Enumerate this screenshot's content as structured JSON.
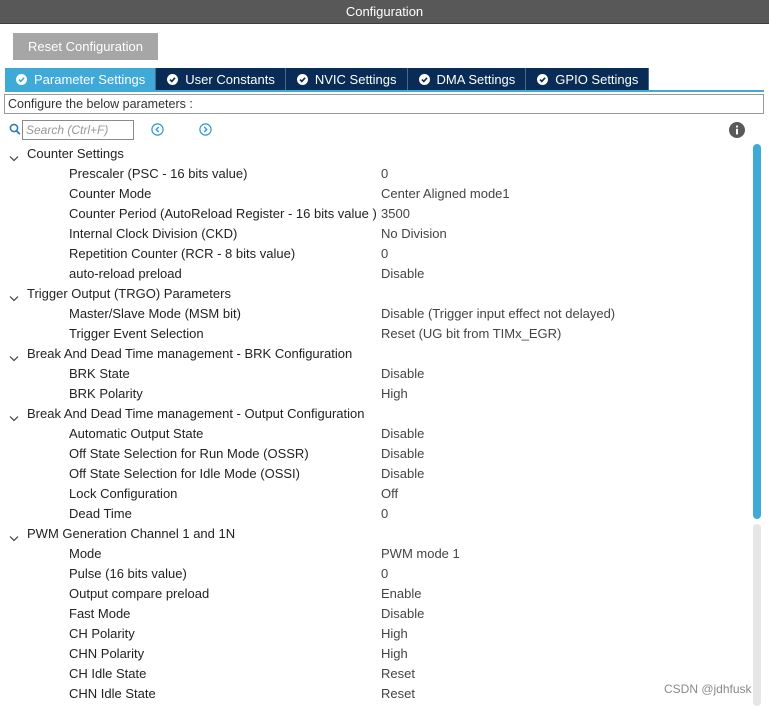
{
  "window": {
    "title": "Configuration"
  },
  "toolbar": {
    "reset_label": "Reset Configuration"
  },
  "tabs": [
    {
      "label": "Parameter Settings",
      "active": true
    },
    {
      "label": "User Constants",
      "active": false
    },
    {
      "label": "NVIC Settings",
      "active": false
    },
    {
      "label": "DMA Settings",
      "active": false
    },
    {
      "label": "GPIO Settings",
      "active": false
    }
  ],
  "description": "Configure the below parameters :",
  "search": {
    "placeholder": "Search (Ctrl+F)"
  },
  "groups": [
    {
      "name": "Counter Settings",
      "params": [
        {
          "name": "Prescaler (PSC - 16 bits value)",
          "value": "0"
        },
        {
          "name": "Counter Mode",
          "value": "Center Aligned mode1"
        },
        {
          "name": "Counter Period (AutoReload Register - 16 bits value )",
          "value": "3500"
        },
        {
          "name": "Internal Clock Division (CKD)",
          "value": "No Division"
        },
        {
          "name": "Repetition Counter (RCR - 8 bits value)",
          "value": "0"
        },
        {
          "name": "auto-reload preload",
          "value": "Disable"
        }
      ]
    },
    {
      "name": "Trigger Output (TRGO) Parameters",
      "params": [
        {
          "name": "Master/Slave Mode (MSM bit)",
          "value": "Disable (Trigger input effect not delayed)"
        },
        {
          "name": "Trigger Event Selection",
          "value": "Reset (UG bit from TIMx_EGR)"
        }
      ]
    },
    {
      "name": "Break And Dead Time management - BRK Configuration",
      "params": [
        {
          "name": "BRK State",
          "value": "Disable"
        },
        {
          "name": "BRK Polarity",
          "value": "High"
        }
      ]
    },
    {
      "name": "Break And Dead Time management - Output Configuration",
      "params": [
        {
          "name": "Automatic Output State",
          "value": "Disable"
        },
        {
          "name": "Off State Selection for Run Mode (OSSR)",
          "value": "Disable"
        },
        {
          "name": "Off State Selection for Idle Mode (OSSI)",
          "value": "Disable"
        },
        {
          "name": "Lock Configuration",
          "value": "Off"
        },
        {
          "name": "Dead Time",
          "value": "0"
        }
      ]
    },
    {
      "name": "PWM Generation Channel 1 and 1N",
      "params": [
        {
          "name": "Mode",
          "value": "PWM mode 1"
        },
        {
          "name": "Pulse (16 bits value)",
          "value": "0"
        },
        {
          "name": "Output compare preload",
          "value": "Enable"
        },
        {
          "name": "Fast Mode",
          "value": "Disable"
        },
        {
          "name": "CH Polarity",
          "value": "High"
        },
        {
          "name": "CHN Polarity",
          "value": "High"
        },
        {
          "name": "CH Idle State",
          "value": "Reset"
        },
        {
          "name": "CHN Idle State",
          "value": "Reset"
        }
      ]
    }
  ],
  "watermark": "CSDN @jdhfusk",
  "colors": {
    "accent": "#3fa9d8",
    "tab_bg": "#082c55",
    "titlebar": "#585858",
    "button": "#a6a6a6"
  }
}
